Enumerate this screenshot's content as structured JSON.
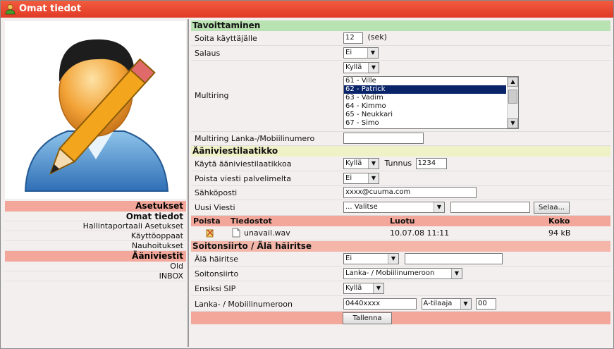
{
  "window": {
    "title": "Omat tiedot"
  },
  "sidebar": {
    "settings_header": "Asetukset",
    "items": [
      "Omat tiedot",
      "Hallintaportaali Asetukset",
      "Käyttöoppaat",
      "Nauhoitukset"
    ],
    "voicemail_header": "Ääniviestit",
    "vm_items": [
      "Old",
      "INBOX"
    ]
  },
  "reach": {
    "title": "Tavoittaminen",
    "call_user_label": "Soita käyttäjälle",
    "call_user_value": "12",
    "call_user_unit": "(sek)",
    "encryption_label": "Salaus",
    "encryption_value": "Ei",
    "multiring_label": "Multiring",
    "multiring_value": "Kyllä",
    "multiring_list": [
      "61 - Ville",
      "62 - Patrick",
      "63 - Vadim",
      "64 - Kimmo",
      "65 - Neukkari",
      "67 - Simo"
    ],
    "multiring_selected": "62 - Patrick",
    "multiring_number_label": "Multiring Lanka-/Mobiilinumero",
    "multiring_number_value": ""
  },
  "voicemail": {
    "title": "Ääniviestilaatikko",
    "use_label": "Käytä ääniviestilaatikkoa",
    "use_value": "Kyllä",
    "pin_label": "Tunnus",
    "pin_value": "1234",
    "delete_label": "Poista viesti palvelimelta",
    "delete_value": "Ei",
    "email_label": "Sähköposti",
    "email_value": "xxxx@cuuma.com",
    "new_msg_label": "Uusi Viesti",
    "new_msg_select": "... Valitse",
    "browse_label": "Selaa...",
    "files": {
      "headers": {
        "delete": "Poista",
        "files": "Tiedostot",
        "created": "Luotu",
        "size": "Koko"
      },
      "rows": [
        {
          "name": "unavail.wav",
          "created": "10.07.08 11:11",
          "size": "94 kB"
        }
      ]
    }
  },
  "forward": {
    "title": "Soitonsiirto / Älä häiritse",
    "dnd_label": "Älä häiritse",
    "dnd_value": "Ei",
    "dnd_text": "",
    "fwd_label": "Soitonsiirto",
    "fwd_value": "Lanka- / Mobiilinumeroon",
    "sip_label": "Ensiksi SIP",
    "sip_value": "Kyllä",
    "phone_label": "Lanka- / Mobiilinumeroon",
    "phone_value": "0440xxxx",
    "sub_value": "A-tilaaja",
    "sub_num": "00"
  },
  "save_label": "Tallenna",
  "colors": {
    "titlebar": "#e84a31",
    "green": "#b8e2b1",
    "yellow": "#eff2c6",
    "salmon": "#f3a79a",
    "selection": "#0a246a"
  }
}
